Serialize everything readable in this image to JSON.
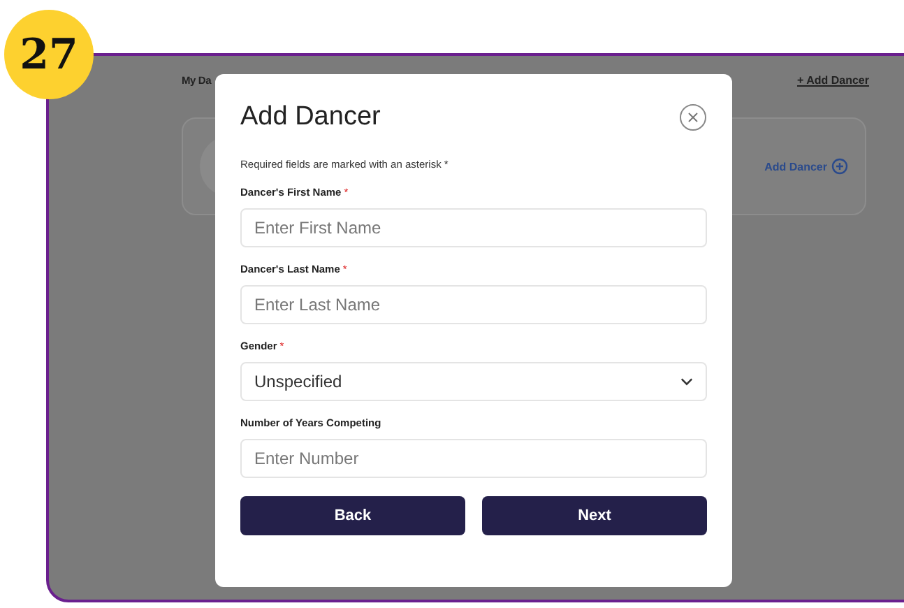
{
  "badge": "27",
  "background": {
    "heading": "My Da",
    "link": "+ Add Dancer",
    "card_action": "Add Dancer"
  },
  "modal": {
    "title": "Add Dancer",
    "note": "Required fields are marked with an asterisk *",
    "required_mark": "*",
    "fields": [
      {
        "kind": "text",
        "label": "Dancer's First Name",
        "required": true,
        "placeholder": "Enter First Name"
      },
      {
        "kind": "text",
        "label": "Dancer's Last Name",
        "required": true,
        "placeholder": "Enter Last Name"
      },
      {
        "kind": "select",
        "label": "Gender",
        "required": true,
        "value": "Unspecified"
      },
      {
        "kind": "text",
        "label": "Number of Years Competing",
        "required": false,
        "placeholder": "Enter Number"
      }
    ],
    "buttons": [
      "Back",
      "Next"
    ]
  }
}
